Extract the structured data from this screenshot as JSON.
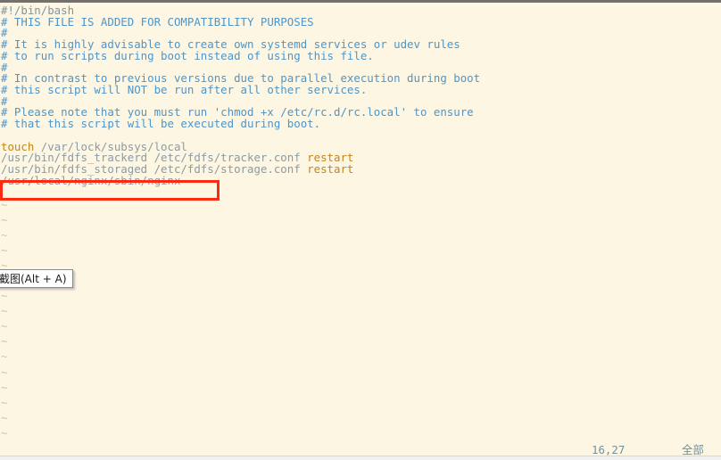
{
  "window": {
    "app": "vim",
    "filename": "/etc/rc.d/rc.local",
    "background_color": "#fdf6e3",
    "top_border_color": "#75716a"
  },
  "colors": {
    "shebang": "#7f96a2",
    "comment": "#4e95c9",
    "command": "#c4841c",
    "path": "#8b9ba3",
    "tilde": "#cfc6ac",
    "annotation_box": "#fc2a10",
    "status_text": "#74919e"
  },
  "code": {
    "lines": [
      {
        "segments": [
          {
            "text": "#!/bin/bash",
            "cls": "c-shebang"
          }
        ]
      },
      {
        "segments": [
          {
            "text": "# THIS FILE IS ADDED FOR COMPATIBILITY PURPOSES",
            "cls": "c-comment"
          }
        ]
      },
      {
        "segments": [
          {
            "text": "#",
            "cls": "c-comment"
          }
        ]
      },
      {
        "segments": [
          {
            "text": "# It is highly advisable to create own systemd services or udev rules",
            "cls": "c-comment"
          }
        ]
      },
      {
        "segments": [
          {
            "text": "# to run scripts during boot instead of using this file.",
            "cls": "c-comment"
          }
        ]
      },
      {
        "segments": [
          {
            "text": "#",
            "cls": "c-comment"
          }
        ]
      },
      {
        "segments": [
          {
            "text": "# In contrast to previous versions due to parallel execution during boot",
            "cls": "c-comment"
          }
        ]
      },
      {
        "segments": [
          {
            "text": "# this script will NOT be run after all other services.",
            "cls": "c-comment"
          }
        ]
      },
      {
        "segments": [
          {
            "text": "#",
            "cls": "c-comment"
          }
        ]
      },
      {
        "segments": [
          {
            "text": "# Please note that you must run 'chmod +x /etc/rc.d/rc.local' to ensure",
            "cls": "c-comment"
          }
        ]
      },
      {
        "segments": [
          {
            "text": "# that this script will be executed during boot.",
            "cls": "c-comment"
          }
        ]
      },
      {
        "segments": [
          {
            "text": "",
            "cls": "c-comment"
          }
        ]
      },
      {
        "segments": [
          {
            "text": "touch",
            "cls": "c-cmd"
          },
          {
            "text": " /var/lock/subsys/local",
            "cls": "c-path"
          }
        ]
      },
      {
        "segments": [
          {
            "text": "/usr/bin/fdfs_trackerd /etc/fdfs/tracker.conf ",
            "cls": "c-path"
          },
          {
            "text": "restart",
            "cls": "c-cmd"
          }
        ]
      },
      {
        "segments": [
          {
            "text": "/usr/bin/fdfs_storaged /etc/fdfs/storage.conf ",
            "cls": "c-path"
          },
          {
            "text": "restart",
            "cls": "c-cmd"
          }
        ]
      },
      {
        "segments": [
          {
            "text": "/usr/local/nginx/sbin/nginx",
            "cls": "c-path"
          }
        ]
      }
    ],
    "empty_line_marker": "~",
    "empty_line_count": 17
  },
  "annotation": {
    "label": "highlight-box",
    "target_text": "/usr/local/nginx/sbin/nginx"
  },
  "tooltip": {
    "text": "截图(Alt + A)"
  },
  "statusbar": {
    "position": "16,27",
    "scroll": "全部"
  }
}
